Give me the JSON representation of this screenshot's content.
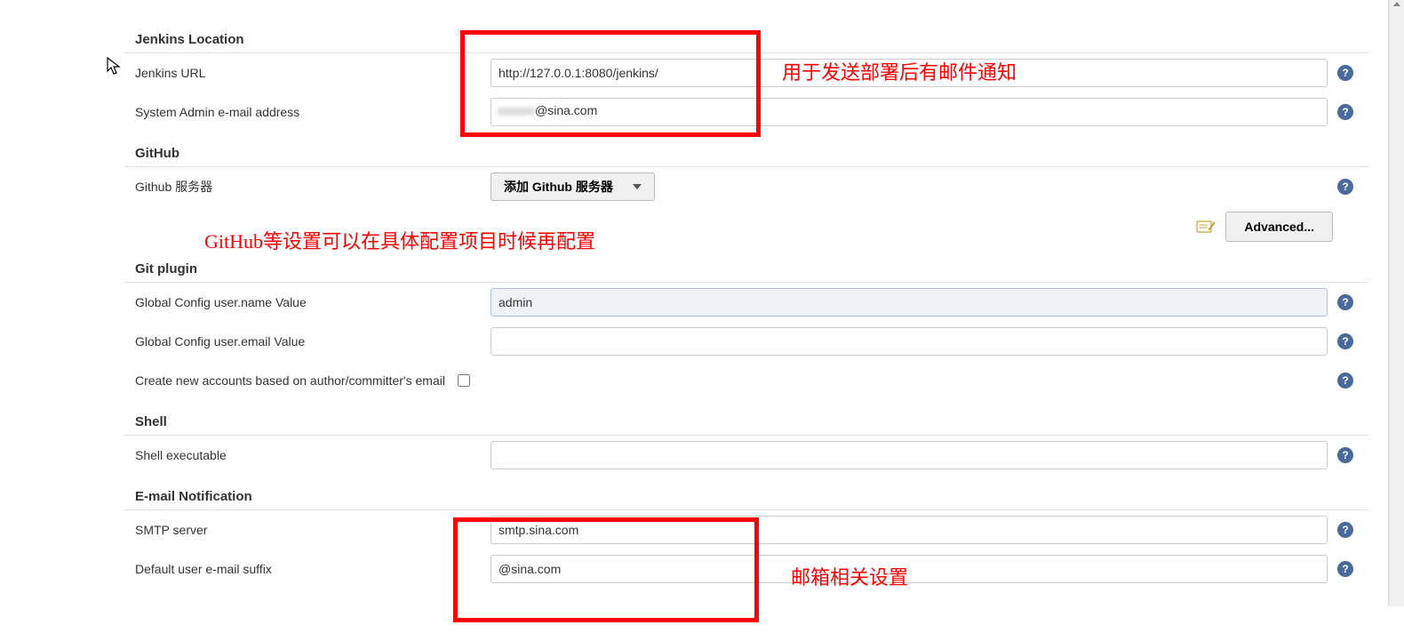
{
  "sections": {
    "jenkinsLocation": {
      "title": "Jenkins Location",
      "jenkinsUrl": {
        "label": "Jenkins URL",
        "value": "http://127.0.0.1:8080/jenkins/"
      },
      "adminEmail": {
        "label": "System Admin e-mail address",
        "value_prefix_masked": "xxxxxx",
        "value_suffix": "@sina.com"
      }
    },
    "github": {
      "title": "GitHub",
      "servers": {
        "label": "Github 服务器",
        "addButton": "添加 Github 服务器"
      },
      "advancedButton": "Advanced..."
    },
    "gitPlugin": {
      "title": "Git plugin",
      "userName": {
        "label": "Global Config user.name Value",
        "value": "admin"
      },
      "userEmail": {
        "label": "Global Config user.email Value",
        "value": ""
      },
      "createAccounts": {
        "label": "Create new accounts based on author/committer's email",
        "checked": false
      }
    },
    "shell": {
      "title": "Shell",
      "executable": {
        "label": "Shell executable",
        "value": ""
      }
    },
    "emailNotification": {
      "title": "E-mail Notification",
      "smtpServer": {
        "label": "SMTP server",
        "value": "smtp.sina.com"
      },
      "defaultSuffix": {
        "label": "Default user e-mail suffix",
        "value": "@sina.com"
      }
    }
  },
  "annotations": {
    "a1": "用于发送部署后有邮件通知",
    "a2": "GitHub等设置可以在具体配置项目时候再配置",
    "a3": "邮箱相关设置"
  },
  "help": "?"
}
